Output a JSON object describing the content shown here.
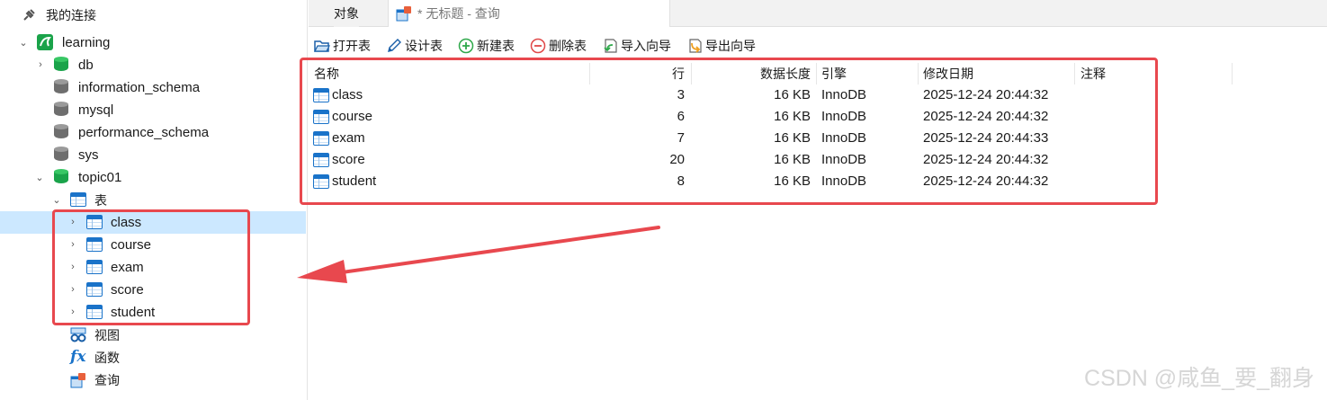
{
  "navigator": {
    "root_label": "我的连接",
    "connection": "learning",
    "databases": [
      "db",
      "information_schema",
      "mysql",
      "performance_schema",
      "sys",
      "topic01"
    ],
    "tables_group": "表",
    "tables": [
      "class",
      "course",
      "exam",
      "score",
      "student"
    ],
    "views_label": "视图",
    "functions_label": "函数",
    "queries_label": "查询"
  },
  "tabs": {
    "objects": "对象",
    "query": "* 无标题 - 查询"
  },
  "toolbar": {
    "open": "打开表",
    "design": "设计表",
    "new": "新建表",
    "delete": "删除表",
    "import": "导入向导",
    "export": "导出向导"
  },
  "grid": {
    "headers": {
      "name": "名称",
      "rows": "行",
      "size": "数据长度",
      "engine": "引擎",
      "modified": "修改日期",
      "comment": "注释"
    },
    "rows": [
      {
        "name": "class",
        "rows": "3",
        "size": "16 KB",
        "engine": "InnoDB",
        "modified": "2025-12-24 20:44:32"
      },
      {
        "name": "course",
        "rows": "6",
        "size": "16 KB",
        "engine": "InnoDB",
        "modified": "2025-12-24 20:44:32"
      },
      {
        "name": "exam",
        "rows": "7",
        "size": "16 KB",
        "engine": "InnoDB",
        "modified": "2025-12-24 20:44:33"
      },
      {
        "name": "score",
        "rows": "20",
        "size": "16 KB",
        "engine": "InnoDB",
        "modified": "2025-12-24 20:44:32"
      },
      {
        "name": "student",
        "rows": "8",
        "size": "16 KB",
        "engine": "InnoDB",
        "modified": "2025-12-24 20:44:32"
      }
    ]
  },
  "colors": {
    "selection": "#cce8ff",
    "annotation_red": "#e8484e",
    "db_green": "#1aa34a"
  },
  "watermark": "CSDN @咸鱼_要_翻身"
}
